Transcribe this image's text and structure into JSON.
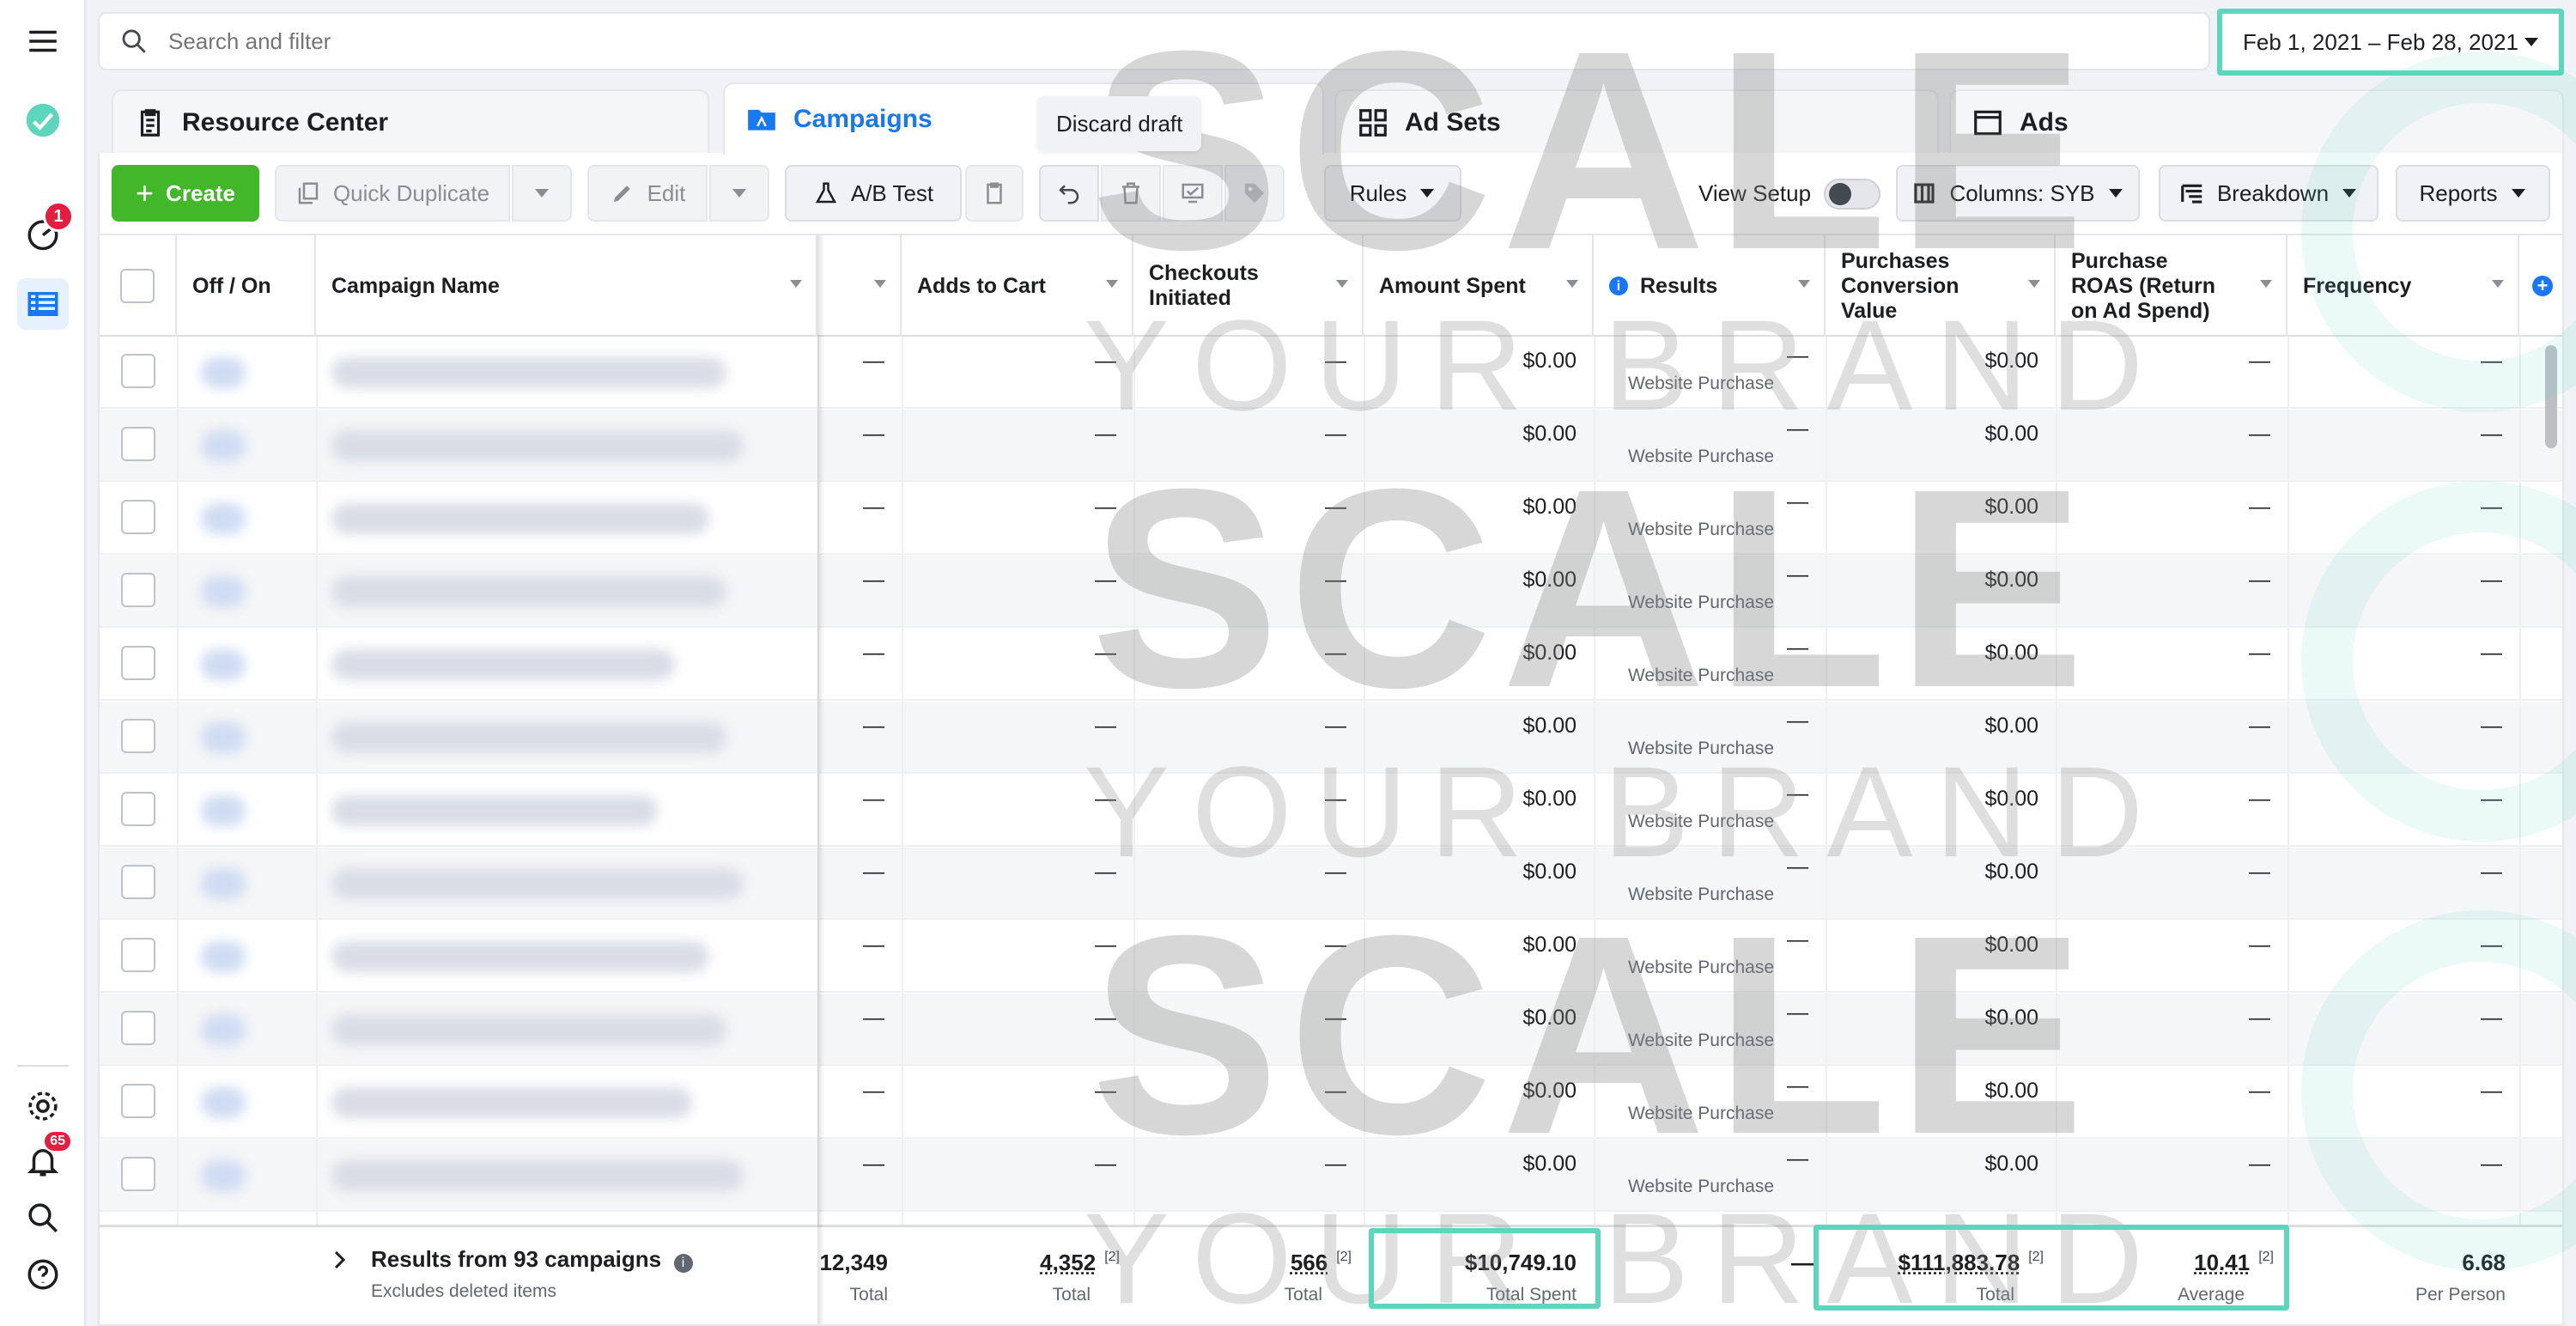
{
  "search": {
    "placeholder": "Search and filter"
  },
  "date_range": {
    "label": "Feb 1, 2021 – Feb 28, 2021"
  },
  "rail": {
    "notification_badge": "1",
    "alerts_badge": "65"
  },
  "tabs": [
    {
      "label": "Resource Center"
    },
    {
      "label": "Campaigns"
    },
    {
      "label": "Ad Sets"
    },
    {
      "label": "Ads"
    }
  ],
  "tooltip": "Discard draft",
  "toolbar": {
    "create": "Create",
    "quick_duplicate": "Quick Duplicate",
    "edit": "Edit",
    "ab_test": "A/B Test",
    "rules": "Rules",
    "view_setup": "View Setup",
    "columns": "Columns: SYB",
    "breakdown": "Breakdown",
    "reports": "Reports"
  },
  "columns": {
    "off_on": "Off / On",
    "campaign_name": "Campaign Name",
    "adds_to_cart": "Adds to Cart",
    "checkouts_initiated": "Checkouts Initiated",
    "amount_spent": "Amount Spent",
    "results": "Results",
    "purchases_conversion_value": "Purchases Conversion Value",
    "purchase_roas": "Purchase ROAS (Return on Ad Spend)",
    "frequency": "Frequency"
  },
  "rows": [
    {
      "amount_spent": "$0.00",
      "results": "—",
      "results_sub": "Website Purchase",
      "conv_value": "$0.00",
      "dash": "—"
    },
    {
      "amount_spent": "$0.00",
      "results": "—",
      "results_sub": "Website Purchase",
      "conv_value": "$0.00",
      "dash": "—"
    },
    {
      "amount_spent": "$0.00",
      "results": "—",
      "results_sub": "Website Purchase",
      "conv_value": "$0.00",
      "dash": "—"
    },
    {
      "amount_spent": "$0.00",
      "results": "—",
      "results_sub": "Website Purchase",
      "conv_value": "$0.00",
      "dash": "—"
    },
    {
      "amount_spent": "$0.00",
      "results": "—",
      "results_sub": "Website Purchase",
      "conv_value": "$0.00",
      "dash": "—"
    },
    {
      "amount_spent": "$0.00",
      "results": "—",
      "results_sub": "Website Purchase",
      "conv_value": "$0.00",
      "dash": "—"
    },
    {
      "amount_spent": "$0.00",
      "results": "—",
      "results_sub": "Website Purchase",
      "conv_value": "$0.00",
      "dash": "—"
    },
    {
      "amount_spent": "$0.00",
      "results": "—",
      "results_sub": "Website Purchase",
      "conv_value": "$0.00",
      "dash": "—"
    },
    {
      "amount_spent": "$0.00",
      "results": "—",
      "results_sub": "Website Purchase",
      "conv_value": "$0.00",
      "dash": "—"
    },
    {
      "amount_spent": "$0.00",
      "results": "—",
      "results_sub": "Website Purchase",
      "conv_value": "$0.00",
      "dash": "—"
    },
    {
      "amount_spent": "$0.00",
      "results": "—",
      "results_sub": "Website Purchase",
      "conv_value": "$0.00",
      "dash": "—"
    },
    {
      "amount_spent": "$0.00",
      "results": "—",
      "results_sub": "Website Purchase",
      "conv_value": "$0.00",
      "dash": "—"
    }
  ],
  "summary": {
    "title": "Results from 93 campaigns",
    "subtitle": "Excludes deleted items",
    "col0_value": "12,349",
    "col0_label": "Total",
    "adds_to_cart_value": "4,352",
    "adds_to_cart_label": "Total",
    "adds_to_cart_fn": "[2]",
    "checkouts_value": "566",
    "checkouts_label": "Total",
    "checkouts_fn": "[2]",
    "amount_spent_value": "$10,749.10",
    "amount_spent_label": "Total Spent",
    "results_value": "—",
    "conv_value_value": "$111,883.78",
    "conv_value_label": "Total",
    "conv_value_fn": "[2]",
    "roas_value": "10.41",
    "roas_label": "Average",
    "roas_fn": "[2]",
    "frequency_value": "6.68",
    "frequency_label": "Per Person"
  },
  "watermark": {
    "brand": "SCALE",
    "tagline": "YOUR BRAND"
  },
  "colors": {
    "accent": "#1877f2",
    "create": "#42b72a",
    "highlight": "#5cd6bd",
    "badge": "#e41e3f"
  }
}
